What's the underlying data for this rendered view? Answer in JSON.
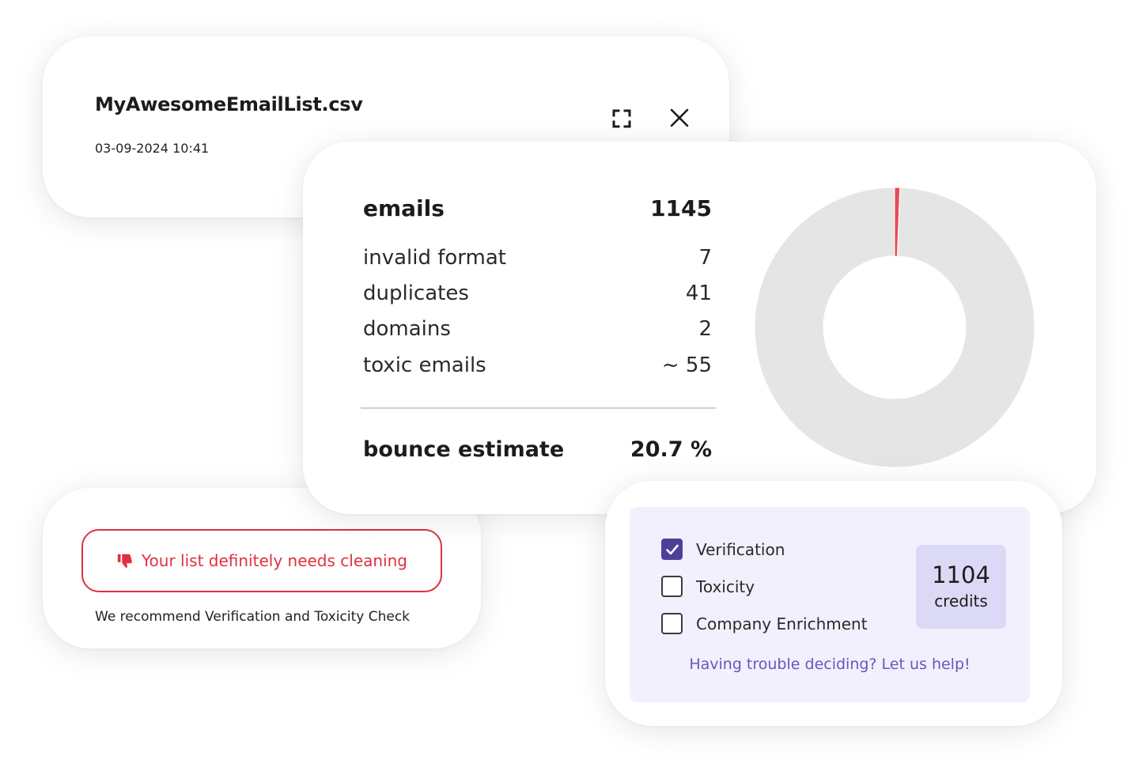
{
  "file": {
    "name": "MyAwesomeEmailList.csv",
    "datetime": "03-09-2024 10:41",
    "expand_icon": "expand-icon",
    "close_icon": "close-icon"
  },
  "stats": {
    "emails_label": "emails",
    "emails_value": "1145",
    "rows": [
      {
        "label": "invalid format",
        "value": "7"
      },
      {
        "label": "duplicates",
        "value": "41"
      },
      {
        "label": "domains",
        "value": "2"
      },
      {
        "label": "toxic emails",
        "value": "~ 55"
      }
    ],
    "bounce_label": "bounce estimate",
    "bounce_value": "20.7 %"
  },
  "donut": {
    "segments": [
      {
        "value": 7,
        "color": "#e84a5a"
      },
      {
        "value": 1138,
        "color": "#e5e5e5"
      }
    ]
  },
  "recommendation": {
    "warning": "Your list definitely needs cleaning",
    "warning_icon": "thumbs-down-icon",
    "text": "We recommend Verification and Toxicity Check",
    "accent_color": "#e0303f"
  },
  "options": {
    "items": [
      {
        "label": "Verification",
        "checked": true
      },
      {
        "label": "Toxicity",
        "checked": false
      },
      {
        "label": "Company Enrichment",
        "checked": false
      }
    ],
    "credits_value": "1104",
    "credits_label": "credits",
    "help_text": "Having trouble deciding? Let us help!",
    "accent_color": "#4f3f98"
  }
}
